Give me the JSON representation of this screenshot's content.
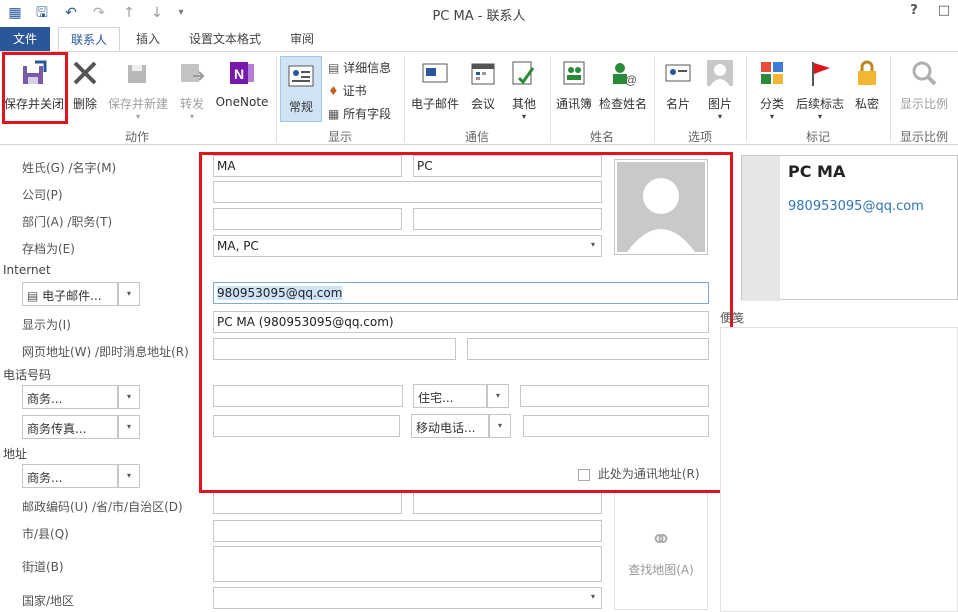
{
  "window": {
    "title": "PC MA - 联系人",
    "help": "?",
    "minimize": "—"
  },
  "tabs": [
    "文件",
    "联系人",
    "插入",
    "设置文本格式",
    "审阅"
  ],
  "ribbon": {
    "actions": {
      "save_close": "保存并关闭",
      "delete": "删除",
      "save_new": "保存并新建",
      "forward": "转发",
      "onenote": "OneNote",
      "group": "动作"
    },
    "show": {
      "general": "常规",
      "details": "详细信息",
      "certificates": "证书",
      "all_fields": "所有字段",
      "group": "显示"
    },
    "communicate": {
      "email": "电子邮件",
      "meeting": "会议",
      "more": "其他",
      "group": "通信"
    },
    "names": {
      "address_book": "通讯簿",
      "check_names": "检查姓名",
      "group": "姓名"
    },
    "options": {
      "business_card": "名片",
      "picture": "图片",
      "group": "选项"
    },
    "tags": {
      "categorize": "分类",
      "follow_up": "后续标志",
      "private": "私密",
      "group": "标记"
    },
    "zoom": {
      "zoom": "显示比例",
      "group": "显示比例"
    }
  },
  "form": {
    "labels": {
      "name": "姓氏(G)  /名字(M)",
      "company": "公司(P)",
      "department": "部门(A)  /职务(T)",
      "file_as": "存档为(E)",
      "internet": "Internet",
      "display_as": "显示为(I)",
      "web_im": "网页地址(W)  /即时消息地址(R)",
      "phone": "电话号码",
      "address": "地址",
      "postal": "邮政编码(U)  /省/市/自治区(D)",
      "city": "市/县(Q)",
      "street": "街道(B)",
      "country": "国家/地区"
    },
    "values": {
      "last_name": "MA",
      "first_name": "PC",
      "company": "",
      "file_as": "MA, PC",
      "email": "980953095@qq.com",
      "display_as": "PC MA (980953095@qq.com)"
    },
    "dropdowns": {
      "email_type": "电子邮件...",
      "phone1": "商务...",
      "phone2": "商务传真...",
      "phone3": "住宅...",
      "phone4": "移动电话...",
      "address_type": "商务..."
    },
    "mailing_checkbox": "此处为通讯地址(R)",
    "map_button": "查找地图(A)",
    "notes_label": "便笺"
  },
  "card": {
    "name": "PC MA",
    "email": "980953095@qq.com"
  },
  "colors": {
    "accent": "#2b579a",
    "highlight_red": "#e0141c",
    "link_blue": "#2e75b6"
  }
}
